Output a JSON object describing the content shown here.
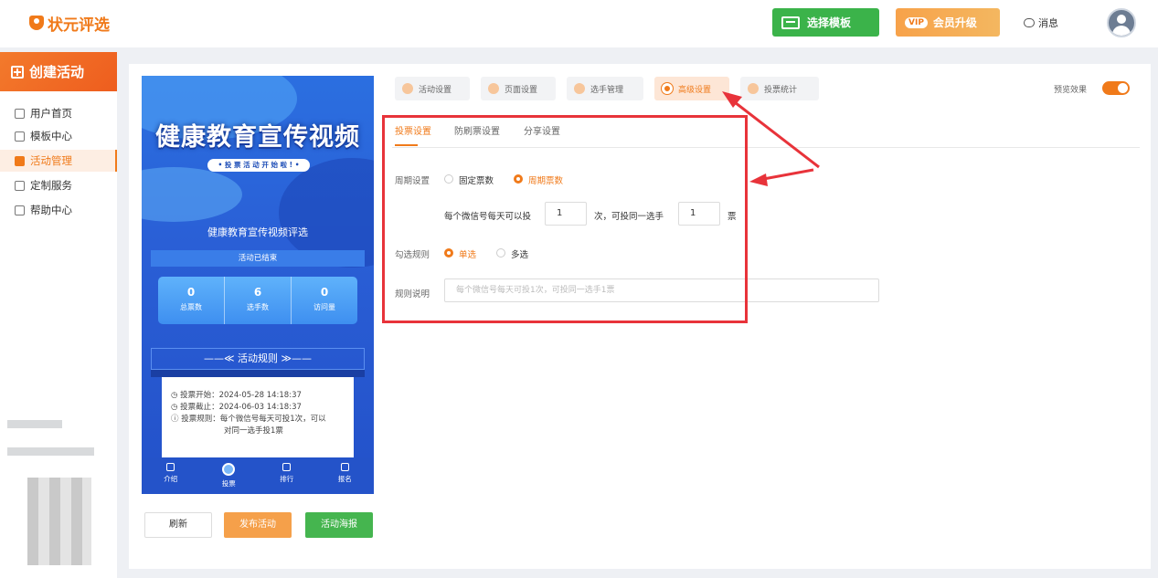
{
  "header": {
    "logo_text": "状元评选",
    "template_btn": "选择模板",
    "vip_badge": "VIP",
    "vip_btn": "会员升级",
    "messages": "消息"
  },
  "sidebar": {
    "create": "创建活动",
    "items": [
      {
        "label": "用户首页",
        "icon": "home-icon"
      },
      {
        "label": "模板中心",
        "icon": "folder-icon"
      },
      {
        "label": "活动管理",
        "icon": "ticket-icon",
        "active": true
      },
      {
        "label": "定制服务",
        "icon": "link-icon"
      },
      {
        "label": "帮助中心",
        "icon": "book-icon"
      }
    ]
  },
  "phone": {
    "title": "健康教育宣传视频",
    "pill": "• 投 票 活 动 开 始 啦 ! •",
    "activity_name": "健康教育宣传视频评选",
    "status": "活动已结束",
    "stats": [
      {
        "value": "0",
        "label": "总票数"
      },
      {
        "value": "6",
        "label": "选手数"
      },
      {
        "value": "0",
        "label": "访问量"
      }
    ],
    "rules_head": "——≪ 活动规则 ≫——",
    "rules": [
      "◷ 投票开始：2024-05-28 14:18:37",
      "◷ 投票截止：2024-06-03 14:18:37",
      "ⓘ 投票规则：每个微信号每天可投1次，可以",
      "对同一选手投1票"
    ],
    "nav": [
      "介绍",
      "投票",
      "排行",
      "报名"
    ]
  },
  "actions": {
    "refresh": "刷新",
    "publish": "发布活动",
    "poster": "活动海报"
  },
  "tabs": [
    "活动设置",
    "页面设置",
    "选手管理",
    "高级设置",
    "投票统计"
  ],
  "active_tab": "高级设置",
  "preview_label": "预览效果",
  "preview_on": true,
  "subtabs": [
    "投票设置",
    "防刷票设置",
    "分享设置"
  ],
  "form": {
    "period_label": "周期设置",
    "period_options": [
      "固定票数",
      "周期票数"
    ],
    "period_selected": "周期票数",
    "per_day_text": "每个微信号每天可以投",
    "times_value": "1",
    "times_text": "次，可投同一选手",
    "votes_value": "1",
    "votes_text": "票",
    "select_label": "勾选规则",
    "select_options": [
      "单选",
      "多选"
    ],
    "select_selected": "单选",
    "desc_label": "规则说明",
    "desc_placeholder": "每个微信号每天可投1次，可投同一选手1票"
  },
  "colors": {
    "accent": "#f07a1a",
    "annotation": "#e8333a",
    "green": "#45b54f"
  }
}
